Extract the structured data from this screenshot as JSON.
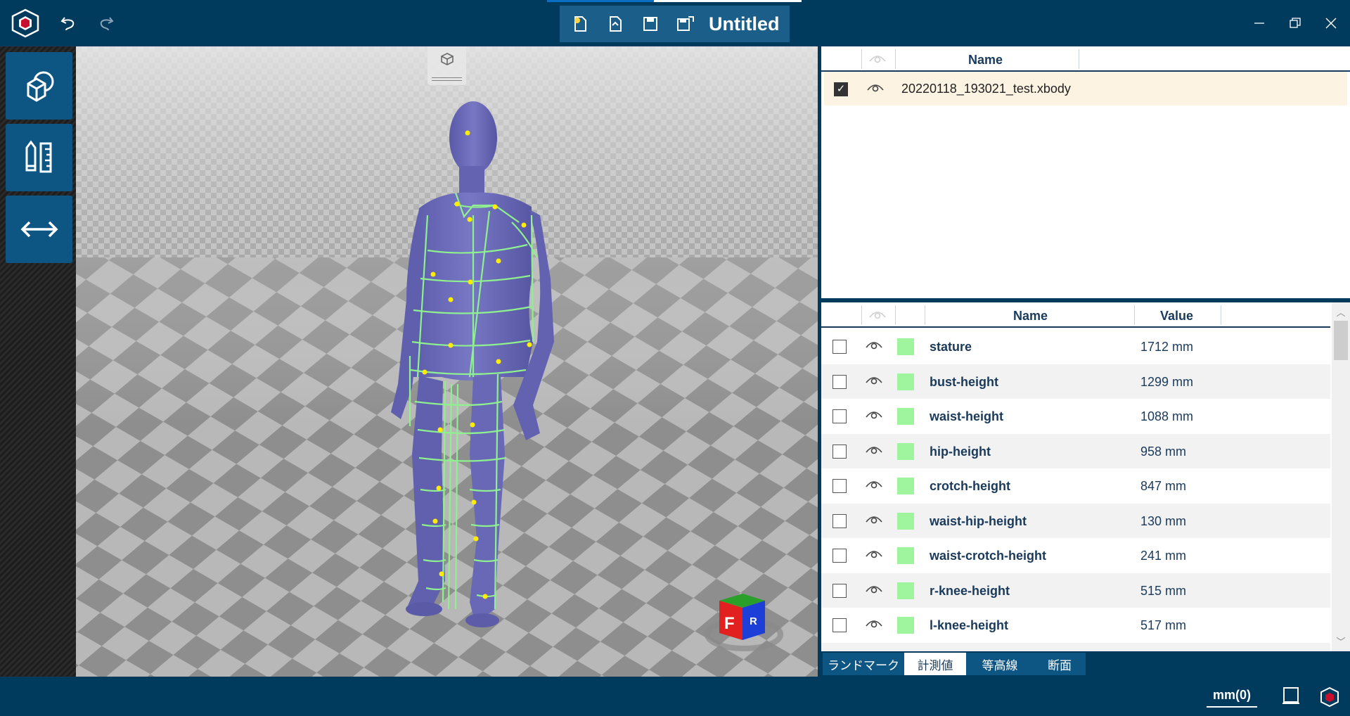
{
  "app": {
    "logo": "hms-cube-logo",
    "document_title": "Untitled",
    "toolbar_icons": [
      "undo-icon",
      "redo-icon",
      "new-file-icon",
      "open-file-icon",
      "save-icon",
      "save-as-icon"
    ],
    "load_progress": 0.42
  },
  "left_tools": [
    {
      "name": "model-tool-button",
      "icon": "body-cube-icon"
    },
    {
      "name": "measure-tool-button",
      "icon": "pencil-ruler-icon"
    },
    {
      "name": "dimension-tool-button",
      "icon": "double-arrow-icon"
    }
  ],
  "files": {
    "header_name": "Name",
    "rows": [
      {
        "checked": true,
        "visible": true,
        "name": "20220118_193021_test.xbody"
      }
    ]
  },
  "measurements": {
    "header_name": "Name",
    "header_value": "Value",
    "rows": [
      {
        "name": "stature",
        "value": "1712 mm",
        "color": "#9ef59e"
      },
      {
        "name": "bust-height",
        "value": "1299 mm",
        "color": "#9ef59e"
      },
      {
        "name": "waist-height",
        "value": "1088 mm",
        "color": "#9ef59e"
      },
      {
        "name": "hip-height",
        "value": "958 mm",
        "color": "#9ef59e"
      },
      {
        "name": "crotch-height",
        "value": "847 mm",
        "color": "#9ef59e"
      },
      {
        "name": "waist-hip-height",
        "value": "130 mm",
        "color": "#9ef59e"
      },
      {
        "name": "waist-crotch-height",
        "value": "241 mm",
        "color": "#9ef59e"
      },
      {
        "name": "r-knee-height",
        "value": "515 mm",
        "color": "#9ef59e"
      },
      {
        "name": "l-knee-height",
        "value": "517 mm",
        "color": "#9ef59e"
      }
    ]
  },
  "tabs": {
    "landmark": "ランドマーク",
    "measure": "計測値",
    "contour": "等高線",
    "section": "断面",
    "active": "measure"
  },
  "status": {
    "unit": "mm(0)"
  },
  "colors": {
    "chrome": "#003a5d",
    "button": "#0d5684",
    "body": "#6b6bb8",
    "measure_line": "#8ef08e",
    "landmark": "#ffee00"
  }
}
